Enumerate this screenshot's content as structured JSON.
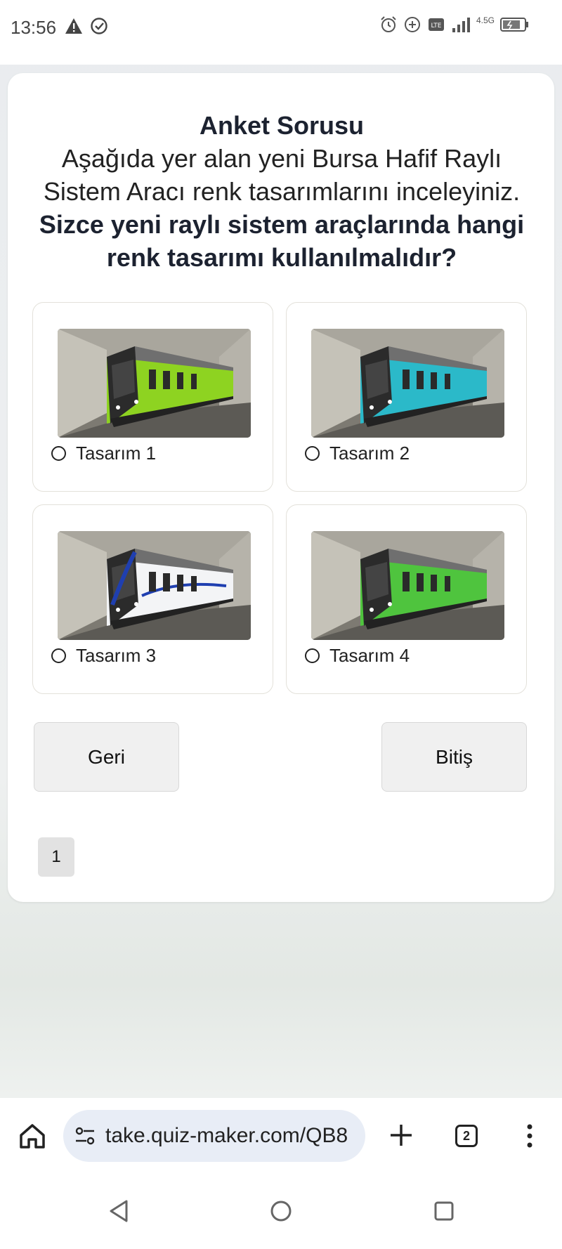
{
  "status_bar": {
    "time": "13:56",
    "left_icons": [
      "warning-icon",
      "check-circle-icon"
    ],
    "right_icons": [
      "alarm-icon",
      "data-saver-icon",
      "volte-icon",
      "signal-icon",
      "network-4-5g-icon",
      "battery-icon"
    ],
    "network_label": "4.5G"
  },
  "survey": {
    "title": "Anket Sorusu",
    "body": "Aşağıda yer alan yeni Bursa Hafif Raylı Sistem Aracı renk tasarımlarını inceleyiniz.",
    "question": "Sizce yeni raylı sistem araçlarında hangi renk tasarımı kullanılmalıdır?",
    "options": [
      {
        "label": "Tasarım 1",
        "color": "#8ed321",
        "accent": "#5a9a12"
      },
      {
        "label": "Tasarım 2",
        "color": "#2bb9c9",
        "accent": "#1a8796"
      },
      {
        "label": "Tasarım 3",
        "color": "#f3f4f6",
        "accent": "#1f3fb0"
      },
      {
        "label": "Tasarım 4",
        "color": "#4fc43e",
        "accent": "#2f8a24"
      }
    ],
    "back_label": "Geri",
    "finish_label": "Bitiş",
    "page_number": "1"
  },
  "browser": {
    "url": "take.quiz-maker.com/QB8",
    "tab_count": "2"
  },
  "colors": {
    "card_bg": "#ffffff",
    "button_bg": "#f0f0f0",
    "url_pill_bg": "#e8edf6"
  }
}
